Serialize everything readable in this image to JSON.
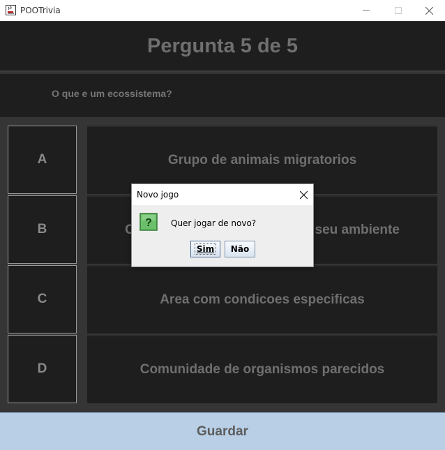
{
  "window": {
    "title": "POOTrivia"
  },
  "header": {
    "question_number": "Pergunta 5 de 5"
  },
  "question": {
    "text": "O que e um ecossistema?"
  },
  "options": [
    {
      "letter": "A",
      "answer": "Grupo de animais migratorios"
    },
    {
      "letter": "B",
      "answer": "Comunidade de seres vivos e seu ambiente"
    },
    {
      "letter": "C",
      "answer": "Area com condicoes especificas"
    },
    {
      "letter": "D",
      "answer": "Comunidade de organismos parecidos"
    }
  ],
  "footer": {
    "save_label": "Guardar"
  },
  "dialog": {
    "title": "Novo jogo",
    "message": "Quer jogar de novo?",
    "yes_label": "Sim",
    "no_label": "Não"
  },
  "colors": {
    "background": "#333333",
    "panel": "#1e1e1e",
    "save_button": "#b8cfe6",
    "question_icon": "#6bbf6b"
  },
  "icons": {
    "app": "java-cup-icon",
    "minimize": "minimize-icon",
    "maximize": "maximize-icon",
    "close": "close-icon",
    "dialog": "question-mark-icon"
  }
}
